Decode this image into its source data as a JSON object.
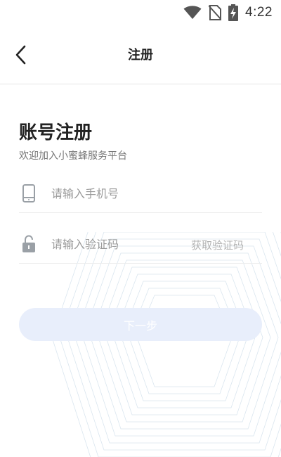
{
  "status_bar": {
    "time": "4:22",
    "icons": [
      "wifi-icon",
      "no-sim-icon",
      "battery-charging-icon"
    ]
  },
  "nav": {
    "back_icon": "chevron-left-icon",
    "title": "注册"
  },
  "form": {
    "heading": "账号注册",
    "subheading": "欢迎加入小蜜蜂服务平台",
    "phone": {
      "icon": "phone-icon",
      "placeholder": "请输入手机号",
      "value": ""
    },
    "code": {
      "icon": "lock-icon",
      "placeholder": "请输入验证码",
      "value": "",
      "get_code_label": "获取验证码"
    },
    "next_label": "下一步"
  },
  "colors": {
    "accent_light": "#e8eefb",
    "muted_text": "#b3b3b3",
    "divider": "#ececec",
    "hex_pattern": "#d3e1ec"
  }
}
